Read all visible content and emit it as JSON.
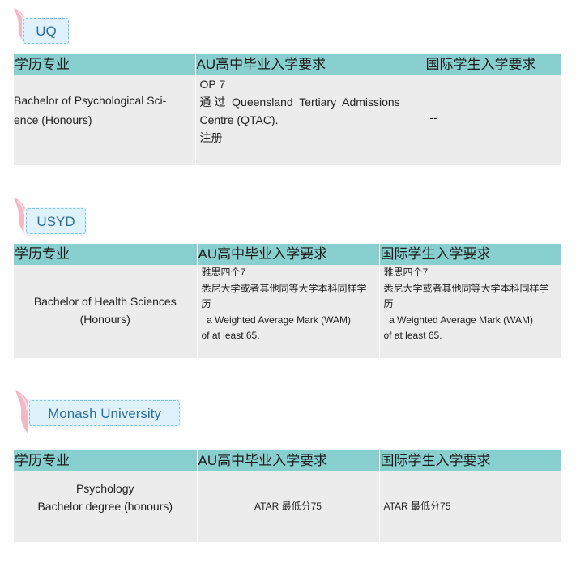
{
  "sections": [
    {
      "university": "UQ",
      "headers": [
        "学历专业",
        "AU高中毕业入学要求",
        "国际学生入学要求"
      ],
      "row": {
        "program": [
          "Bachelor of Psychological Sci-",
          "ence (Honours)"
        ],
        "au_req": [
          "OP 7",
          "通 过  Queensland  Tertiary  Admissions",
          "Centre (QTAC).",
          "注册"
        ],
        "intl_req": [
          "--"
        ]
      }
    },
    {
      "university": "USYD",
      "headers": [
        "学历专业",
        "AU高中毕业入学要求",
        "国际学生入学要求"
      ],
      "row": {
        "program": [
          "Bachelor of Health Sciences",
          "(Honours)"
        ],
        "au_req": [
          "雅思四个7",
          "悉尼大学或者其他同等大学本科同样学",
          "历",
          "  a Weighted Average Mark (WAM)",
          "of at least 65."
        ],
        "intl_req": [
          "雅思四个7",
          "悉尼大学或者其他同等大学本科同样学",
          "历",
          "  a Weighted Average Mark (WAM)",
          "of at least 65."
        ]
      }
    },
    {
      "university": "Monash University",
      "headers": [
        "学历专业",
        "AU高中毕业入学要求",
        "国际学生入学要求"
      ],
      "row": {
        "program": [
          "Psychology",
          "Bachelor degree (honours)"
        ],
        "au_req": [
          "ATAR 最低分75"
        ],
        "intl_req": [
          "ATAR 最低分75"
        ]
      }
    }
  ],
  "colors": {
    "header_bg": "#88cfcf",
    "row_bg": "#ececec",
    "tag_bg": "#dff1fb",
    "tag_text": "#2a6fa0",
    "ribbon": "#f3b8c4"
  },
  "icons": [
    "ribbon-icon"
  ]
}
